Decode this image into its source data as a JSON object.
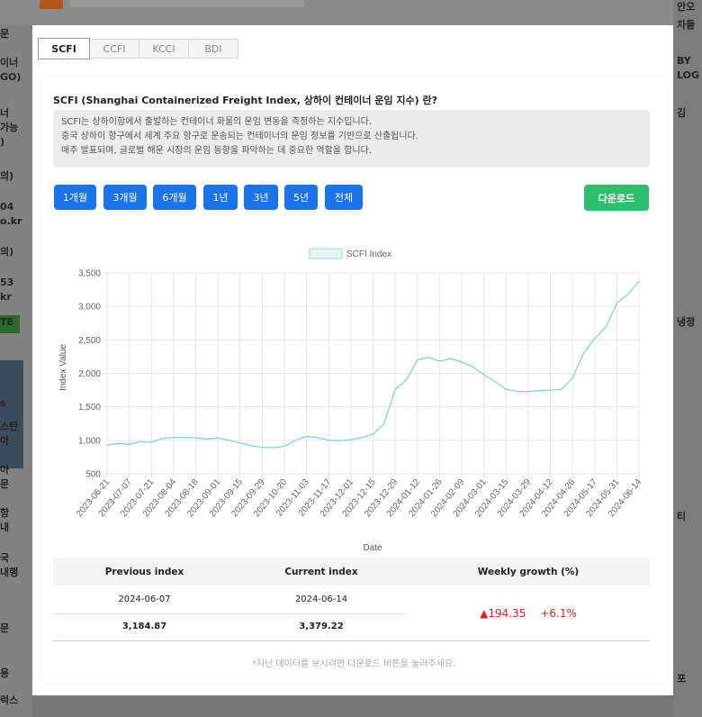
{
  "background": {
    "left_texts": [
      "문",
      "이너\nGO)",
      "너\n가능\n)",
      "의)",
      "04\no.kr",
      "의)",
      "53\nkr",
      "TE",
      "s",
      "스탄\n아",
      "아\n문",
      "항\n내",
      "국\n내행",
      "문",
      "용",
      "럭스"
    ],
    "right_texts": [
      "안오",
      "차들",
      "BY\nLOG",
      "김",
      "냉정",
      "티",
      "포"
    ]
  },
  "tabs": [
    "SCFI",
    "CCFI",
    "KCCI",
    "BDI"
  ],
  "active_tab": "SCFI",
  "info": {
    "title": "SCFI (Shanghai Containerized Freight Index, 상하이 컨테이너 운임 지수) 란?",
    "desc": [
      "SCFI는 상하이항에서 출발하는 컨테이너 화물의 운임 변동을 측정하는 지수입니다.",
      "중국 상하이 항구에서 세계 주요 항구로 운송되는 컨테이너의 운임 정보를 기반으로 산출됩니다.",
      "매주 발표되며, 글로벌 해운 시장의 운임 동향을 파악하는 데 중요한 역할을 합니다."
    ]
  },
  "range_buttons": [
    "1개월",
    "3개월",
    "6개월",
    "1년",
    "3년",
    "5년",
    "전체"
  ],
  "download_label": "다운로드",
  "accent_blue": "#1a73e8",
  "accent_green": "#2dbf6c",
  "line_color": "#7fd3d6",
  "chart_data": {
    "type": "line",
    "legend": "SCFI Index",
    "legend_position": "top",
    "xlabel": "Date",
    "ylabel": "Index Value",
    "ylim": [
      500,
      3500
    ],
    "yticks": [
      500,
      1000,
      1500,
      2000,
      2500,
      3000,
      3500
    ],
    "ytick_labels": [
      "500",
      "1,000",
      "1,500",
      "2,000",
      "2,500",
      "3,000",
      "3,500"
    ],
    "grid": true,
    "x_tick_labels": [
      "2023-06-21",
      "2023-07-07",
      "2023-07-21",
      "2023-08-04",
      "2023-08-18",
      "2023-09-01",
      "2023-09-15",
      "2023-09-29",
      "2023-10-20",
      "2023-11-03",
      "2023-11-17",
      "2023-12-01",
      "2023-12-15",
      "2023-12-29",
      "2024-01-12",
      "2024-01-26",
      "2024-02-09",
      "2024-03-01",
      "2024-03-15",
      "2024-03-29",
      "2024-04-12",
      "2024-04-26",
      "2024-05-17",
      "2024-05-31",
      "2024-06-14"
    ],
    "series": [
      {
        "name": "SCFI Index",
        "values": [
          930,
          955,
          940,
          980,
          970,
          1030,
          1040,
          1045,
          1035,
          1020,
          1035,
          1000,
          960,
          920,
          895,
          890,
          910,
          1000,
          1060,
          1040,
          1000,
          995,
          1010,
          1040,
          1090,
          1250,
          1760,
          1900,
          2200,
          2240,
          2180,
          2220,
          2170,
          2100,
          1980,
          1880,
          1760,
          1730,
          1730,
          1740,
          1750,
          1760,
          1930,
          2300,
          2520,
          2690,
          3050,
          3180,
          3379
        ]
      }
    ]
  },
  "table": {
    "headers": [
      "Previous index",
      "Current index",
      "Weekly growth (%)"
    ],
    "prev_date": "2024-06-07",
    "curr_date": "2024-06-14",
    "prev_value": "3,184.87",
    "curr_value": "3,379.22",
    "growth_abs": "▲194.35",
    "growth_pct": "+6.1%"
  },
  "footnote": "*지난 데이터를 보시려면 다운로드 버튼을 눌러주세요."
}
